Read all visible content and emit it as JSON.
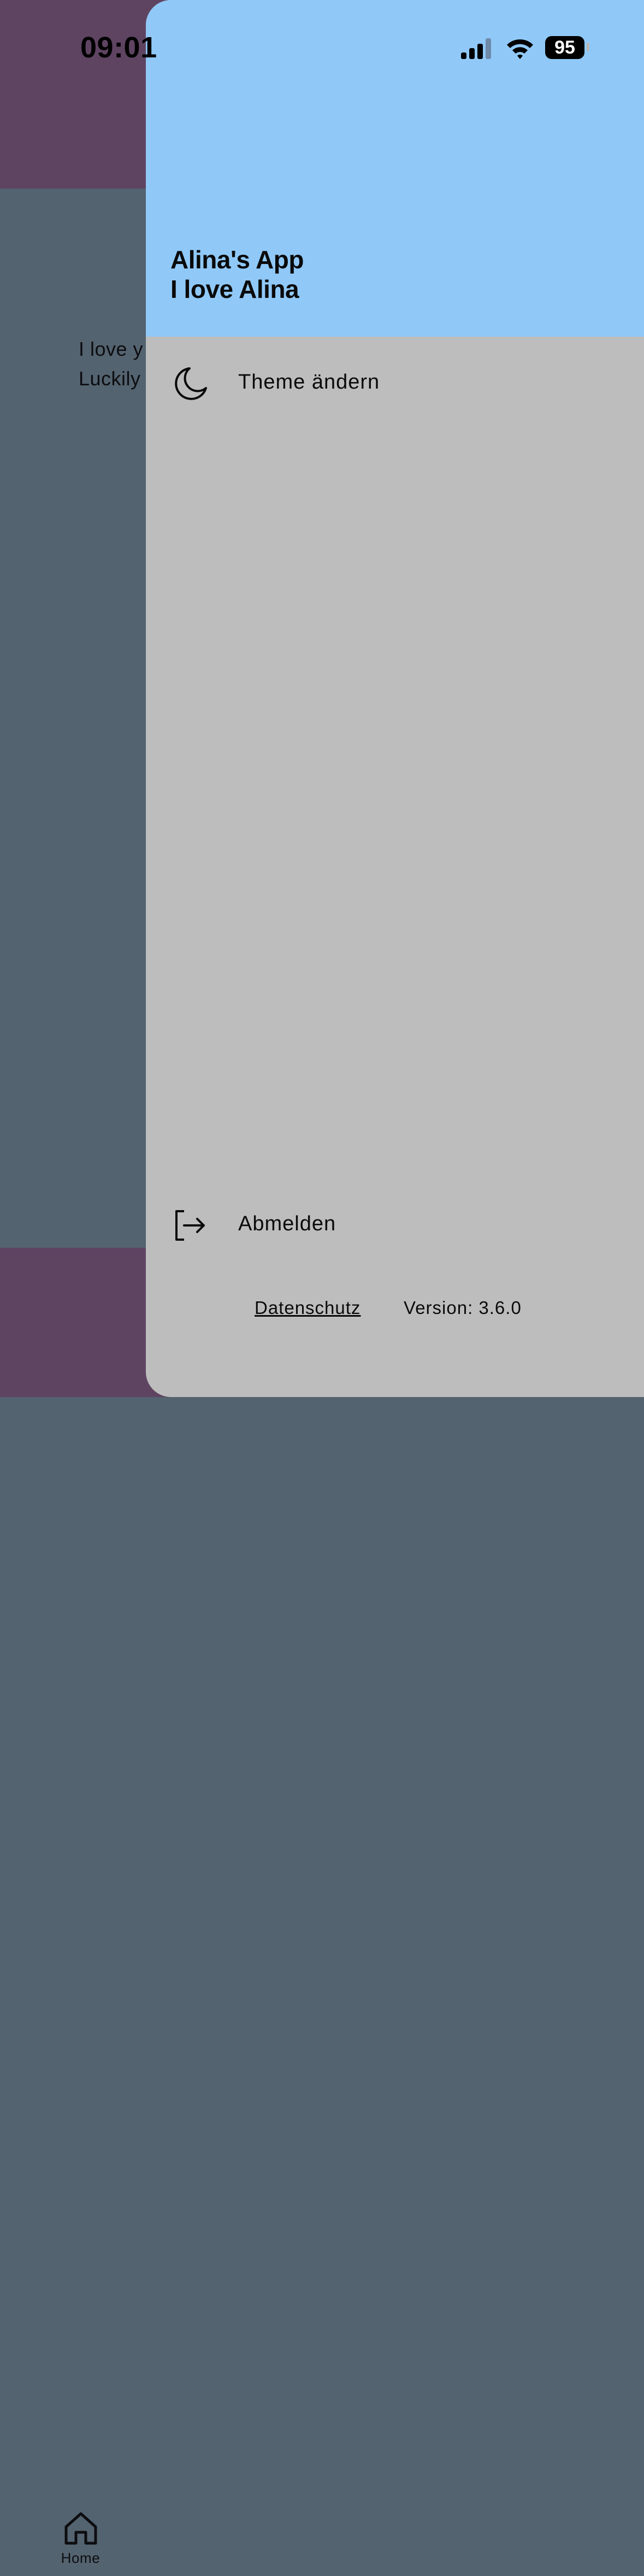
{
  "status_bar": {
    "time": "09:01",
    "battery": "95",
    "icons": [
      "signal-icon",
      "wifi-icon",
      "battery-icon"
    ]
  },
  "background": {
    "content_lines": [
      "I love y",
      "Luckily"
    ],
    "bottom_nav": {
      "home_label": "Home",
      "home_icon": "home-icon"
    },
    "colors": {
      "topbar": "#5f4462",
      "content": "#53636f"
    }
  },
  "drawer": {
    "header": {
      "title": "Alina's App",
      "subtitle": "I love Alina",
      "color": "#90c9f8"
    },
    "items": [
      {
        "label": "Theme ändern",
        "icon": "moon-icon"
      },
      {
        "label": "Abmelden",
        "icon": "logout-icon"
      }
    ],
    "footer": {
      "privacy_label": "Datenschutz",
      "version_label": "Version: 3.6.0"
    },
    "color": "#bdbdbd"
  }
}
